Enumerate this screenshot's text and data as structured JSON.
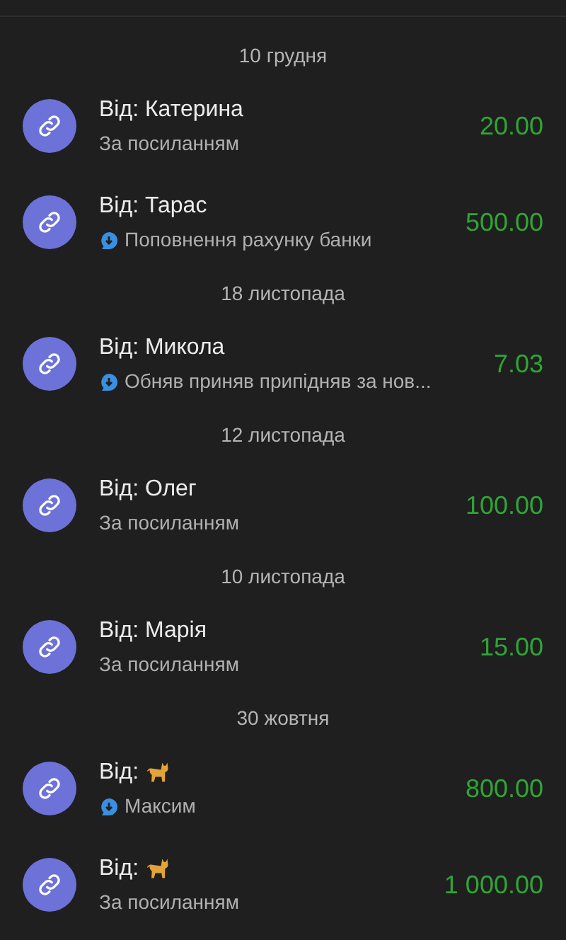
{
  "groups": [
    {
      "date": "10 грудня",
      "items": [
        {
          "title": "Від: Катерина",
          "kind": "name",
          "comment": false,
          "subtitle": "За посиланням",
          "amount": "20.00"
        },
        {
          "title": "Від: Тарас",
          "kind": "name",
          "comment": true,
          "subtitle": "Поповнення рахунку банки",
          "amount": "500.00"
        }
      ]
    },
    {
      "date": "18 листопада",
      "items": [
        {
          "title": "Від: Микола",
          "kind": "name",
          "comment": true,
          "subtitle": "Обняв приняв припідняв за нов...",
          "amount": "7.03"
        }
      ]
    },
    {
      "date": "12 листопада",
      "items": [
        {
          "title": "Від: Олег",
          "kind": "name",
          "comment": false,
          "subtitle": "За посиланням",
          "amount": "100.00"
        }
      ]
    },
    {
      "date": "10 листопада",
      "items": [
        {
          "title": "Від: Марія",
          "kind": "name",
          "comment": false,
          "subtitle": "За посиланням",
          "amount": "15.00"
        }
      ]
    },
    {
      "date": "30 жовтня",
      "items": [
        {
          "title": "Від:",
          "kind": "cat",
          "comment": true,
          "subtitle": "Максим",
          "amount": "800.00"
        },
        {
          "title": "Від:",
          "kind": "cat",
          "comment": false,
          "subtitle": "За посиланням",
          "amount": "1 000.00"
        }
      ]
    }
  ]
}
